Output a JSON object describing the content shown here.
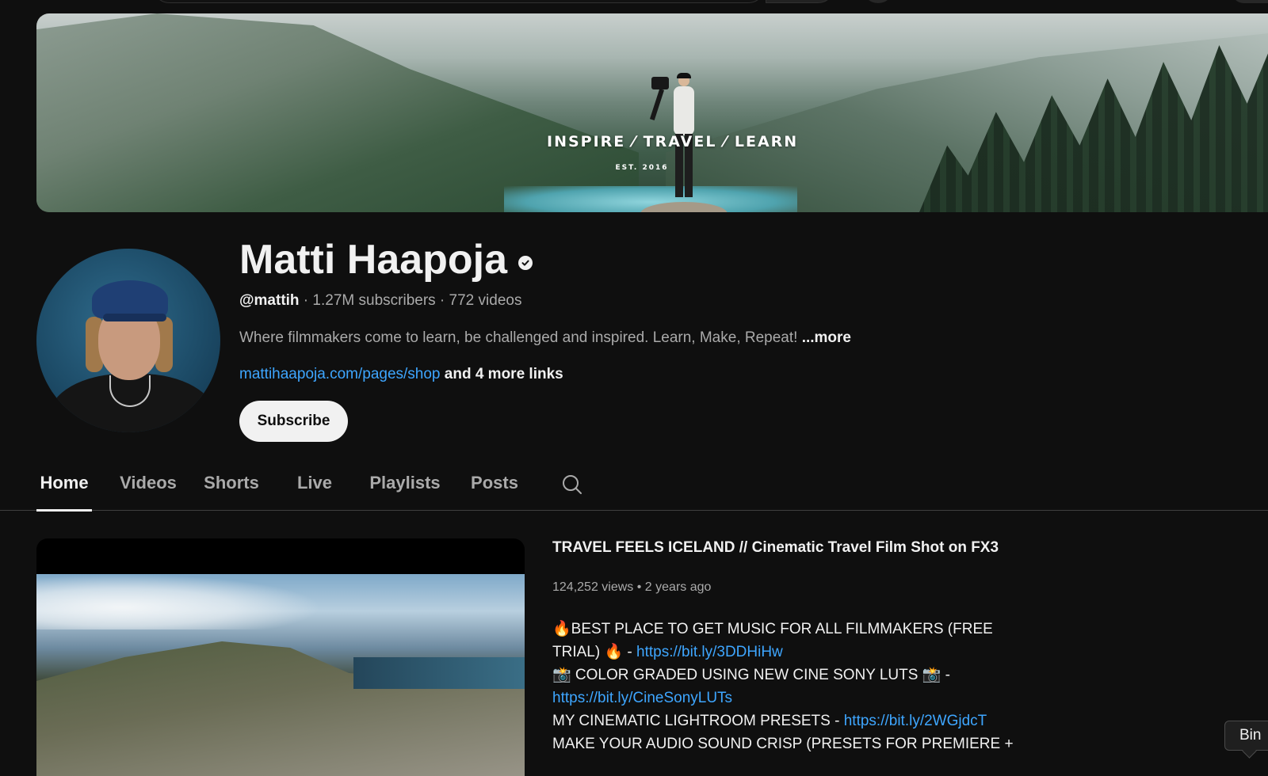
{
  "banner": {
    "tagline": "INSPIRE ⁄ TRAVEL ⁄ LEARN",
    "est": "EST. 2016"
  },
  "channel": {
    "name": "Matti Haapoja",
    "handle": "@mattih",
    "subscribers": "1.27M subscribers",
    "videos": "772 videos",
    "separator": " · ",
    "description": "Where filmmakers come to learn, be challenged and inspired. Learn, Make, Repeat!",
    "more_label": "...more",
    "link_text": "mattihaapoja.com/pages/shop",
    "more_links": "and 4 more links",
    "subscribe_label": "Subscribe",
    "verified_icon": "verified-check-icon"
  },
  "tabs": [
    {
      "label": "Home",
      "active": true
    },
    {
      "label": "Videos",
      "active": false
    },
    {
      "label": "Shorts",
      "active": false
    },
    {
      "label": "Live",
      "active": false
    },
    {
      "label": "Playlists",
      "active": false
    },
    {
      "label": "Posts",
      "active": false
    }
  ],
  "featured_video": {
    "title": "TRAVEL FEELS ICELAND // Cinematic Travel Film Shot on FX3",
    "views": "124,252 views",
    "age": "2 years ago",
    "desc": {
      "line1": "🔥BEST PLACE TO GET MUSIC FOR ALL FILMMAKERS (FREE",
      "line2_text": "TRIAL) 🔥 - ",
      "line2_link": "https://bit.ly/3DDHiHw",
      "line3": "📸  COLOR GRADED USING NEW CINE SONY LUTS  📸 -",
      "line4_link": "https://bit.ly/CineSonyLUTs",
      "line5_text": "MY CINEMATIC LIGHTROOM PRESETS - ",
      "line5_link": "https://bit.ly/2WGjdcT",
      "line6": "MAKE YOUR AUDIO SOUND CRISP (PRESETS FOR PREMIERE +"
    }
  },
  "tooltip": {
    "label": "Bin"
  },
  "colors": {
    "background": "#0f0f0f",
    "link": "#3ea6ff",
    "text_primary": "#f1f1f1",
    "text_secondary": "#aaaaaa"
  }
}
